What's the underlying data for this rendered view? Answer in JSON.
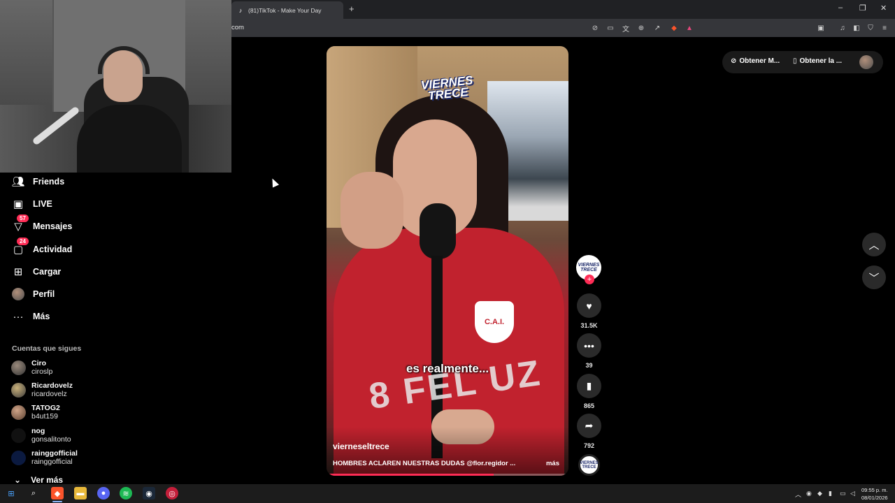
{
  "browser": {
    "tab_title": "(81)TikTok - Make Your Day",
    "new_tab_symbol": "+",
    "url": "com",
    "window_controls": [
      "–",
      "❐",
      "✕"
    ]
  },
  "sidebar": {
    "items": [
      {
        "icon": "friends-icon",
        "label": "Friends"
      },
      {
        "icon": "live-icon",
        "label": "LIVE"
      },
      {
        "icon": "messages-icon",
        "label": "Mensajes",
        "badge": "57"
      },
      {
        "icon": "activity-icon",
        "label": "Actividad",
        "badge": "24"
      },
      {
        "icon": "upload-icon",
        "label": "Cargar"
      },
      {
        "icon": "profile-icon",
        "label": "Perfil"
      },
      {
        "icon": "more-icon",
        "label": "Más"
      }
    ],
    "following_title": "Cuentas que sigues",
    "following": [
      {
        "name": "Ciro",
        "handle": "ciroslp"
      },
      {
        "name": "Ricardovelz",
        "handle": "ricardovelz"
      },
      {
        "name": "TATOG2",
        "handle": "b4ut159"
      },
      {
        "name": "nog",
        "handle": "gonsalitonto"
      },
      {
        "name": "rainggofficial",
        "handle": "rainggofficial"
      }
    ],
    "see_more": "Ver más"
  },
  "video": {
    "logo_text": "VIERNES TRECE",
    "caption": "es realmente...",
    "author": "vierneseltrece",
    "description": "HOMBRES ACLAREN NUESTRAS DUDAS @flor.regidor ...",
    "more_label": "más",
    "crest_text": "C.A.I.",
    "jersey_text": "8 FEL UZ",
    "progress": 0.69
  },
  "actions": {
    "avatar_text": "VIERNES TRECE",
    "likes": "31.5K",
    "comments": "39",
    "saves": "865",
    "shares": "792"
  },
  "top_right": {
    "btn1": "Obtener M...",
    "btn2": "Obtener la ..."
  },
  "taskbar": {
    "time": "09:55 p. m.",
    "date": "08/01/2026"
  },
  "colors": {
    "accent": "#fe2c55",
    "background": "#000000",
    "brand_blue": "#1d2a6b"
  }
}
